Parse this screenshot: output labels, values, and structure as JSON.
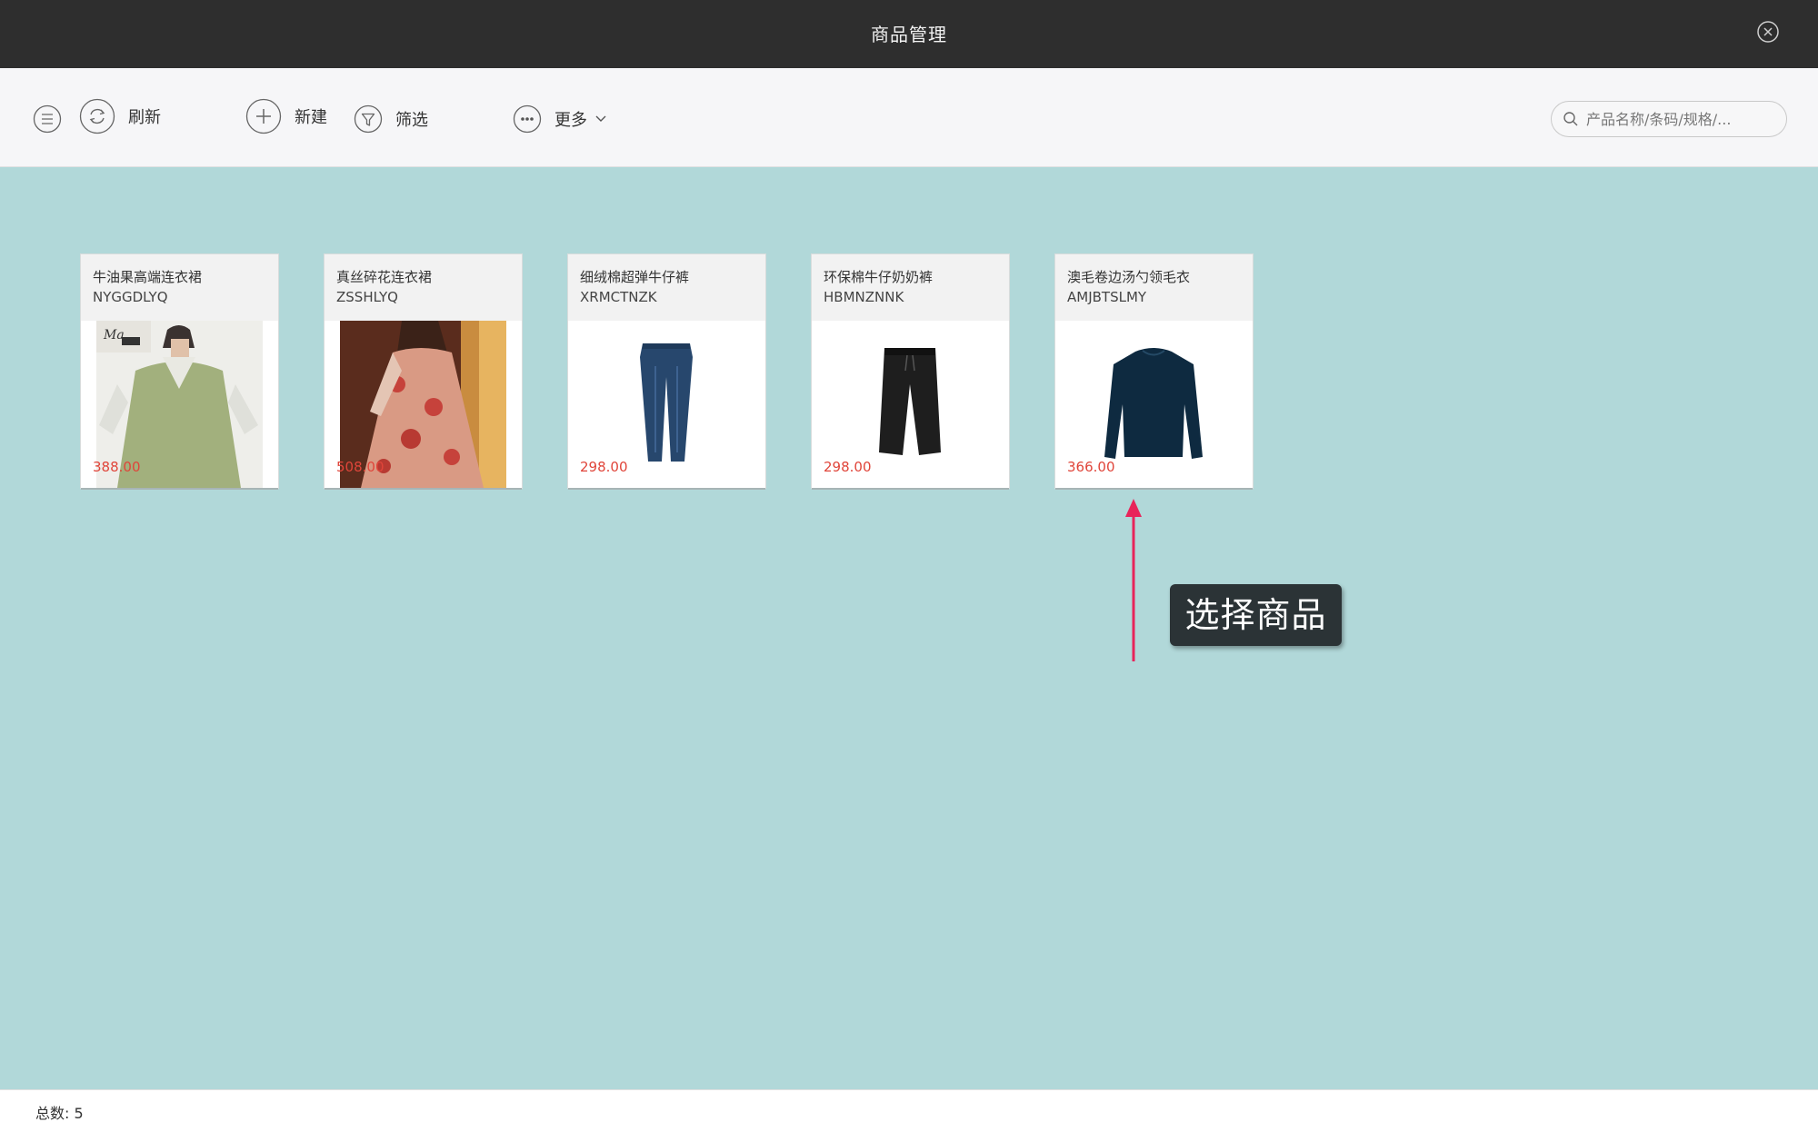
{
  "window": {
    "title": "商品管理"
  },
  "toolbar": {
    "refresh_label": "刷新",
    "new_label": "新建",
    "filter_label": "筛选",
    "more_label": "更多"
  },
  "search": {
    "placeholder": "产品名称/条码/规格/..."
  },
  "products": [
    {
      "name": "牛油果高端连衣裙",
      "code": "NYGGDLYQ",
      "price": "388.00"
    },
    {
      "name": "真丝碎花连衣裙",
      "code": "ZSSHLYQ",
      "price": "508.00"
    },
    {
      "name": "细绒棉超弹牛仔裤",
      "code": "XRMCTNZK",
      "price": "298.00"
    },
    {
      "name": "环保棉牛仔奶奶裤",
      "code": "HBMNZNNK",
      "price": "298.00"
    },
    {
      "name": "澳毛卷边汤勺领毛衣",
      "code": "AMJBTSLMY",
      "price": "366.00"
    }
  ],
  "annotation": {
    "tooltip": "选择商品"
  },
  "footer": {
    "total_label": "总数:  5"
  },
  "colors": {
    "price": "#e0453a",
    "background": "#b1d8d9",
    "titlebar": "#2e2e2e",
    "arrow": "#e8245a"
  }
}
